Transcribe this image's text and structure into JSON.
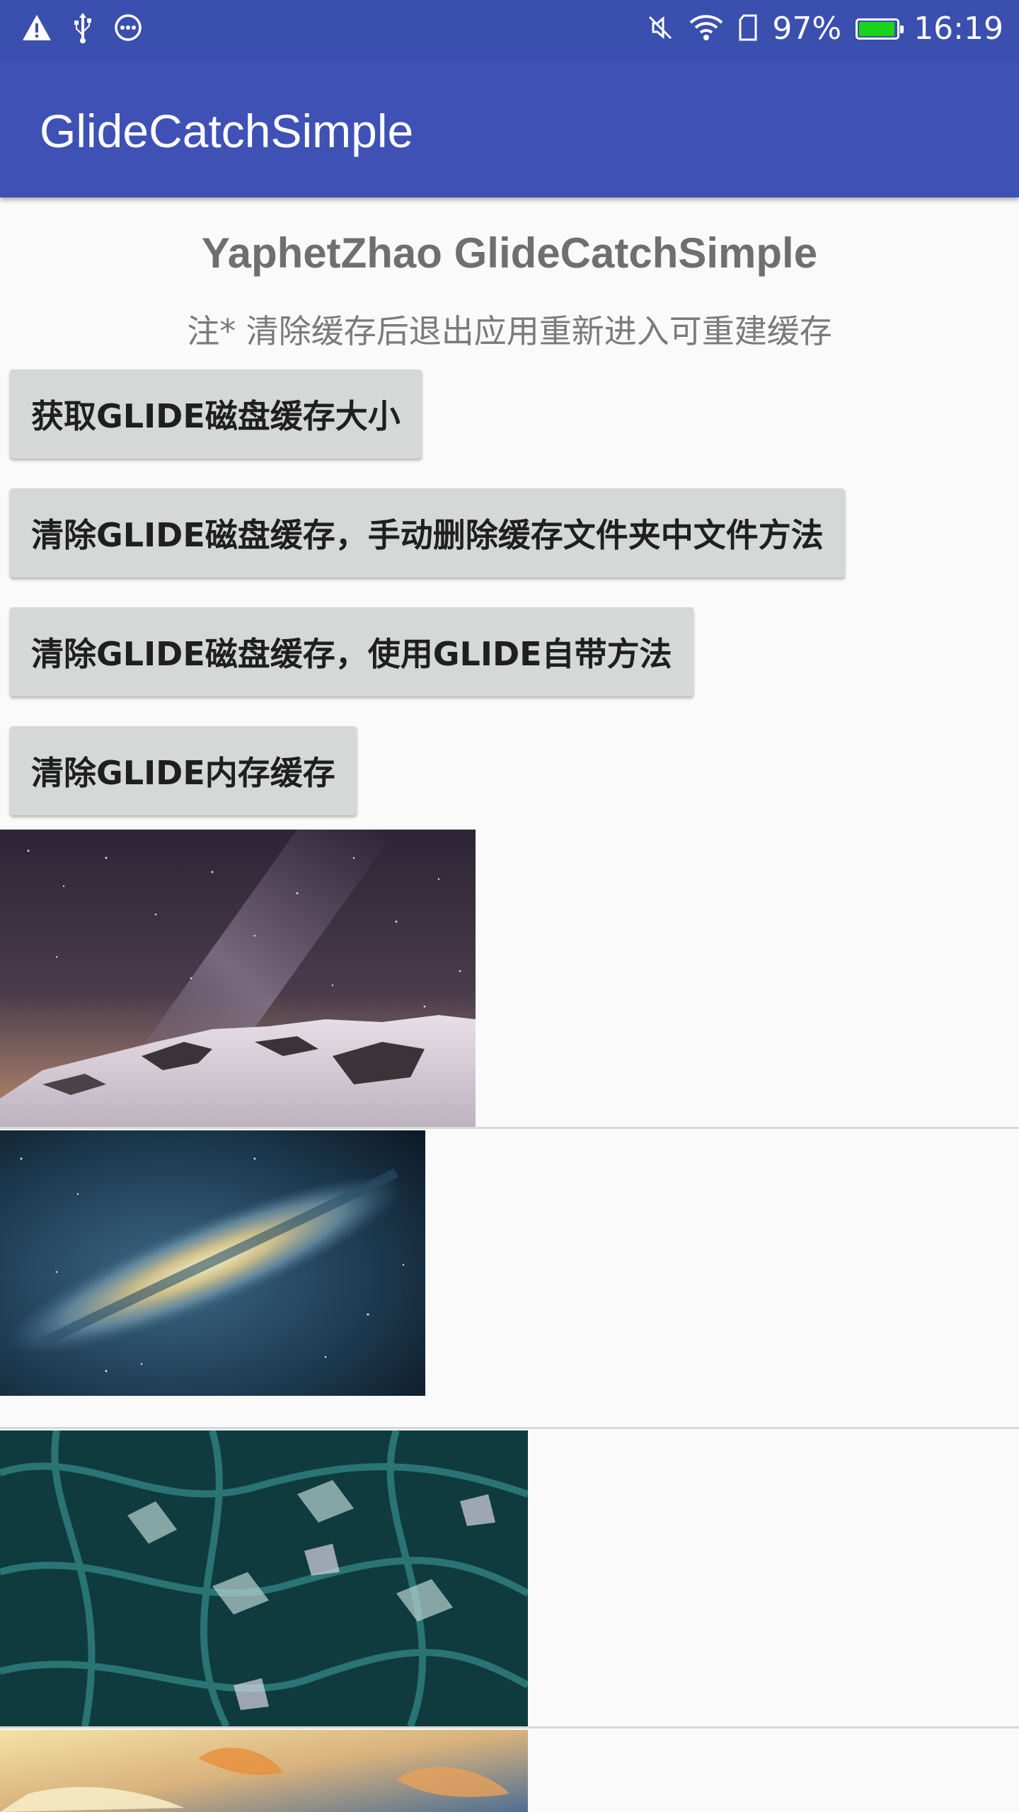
{
  "status_bar": {
    "left_icons": [
      "warning-icon",
      "usb-icon",
      "more-icon"
    ],
    "right_icons": [
      "mute-icon",
      "wifi-icon",
      "sim-icon",
      "battery-icon"
    ],
    "battery_percent": "97%",
    "battery_level": 0.97,
    "time": "16:19",
    "battery_color": "#19d419"
  },
  "app_bar": {
    "title": "GlideCatchSimple",
    "color": "#3f51b5"
  },
  "content": {
    "title": "YaphetZhao GlideCatchSimple",
    "note": "注* 清除缓存后退出应用重新进入可重建缓存",
    "buttons": [
      {
        "label": "获取GLIDE磁盘缓存大小"
      },
      {
        "label": "清除GLIDE磁盘缓存，手动删除缓存文件夹中文件方法"
      },
      {
        "label": "清除GLIDE磁盘缓存，使用GLIDE自带方法"
      },
      {
        "label": "清除GLIDE内存缓存"
      }
    ],
    "images": [
      {
        "subject": "starry-sky-mountain"
      },
      {
        "subject": "galaxy"
      },
      {
        "subject": "teal-fractal"
      },
      {
        "subject": "sunset-clouds"
      }
    ]
  }
}
